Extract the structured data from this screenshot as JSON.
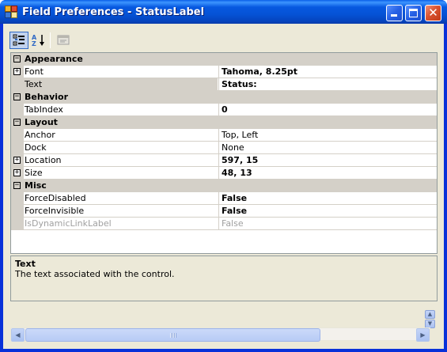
{
  "window": {
    "title": "Field Preferences - StatusLabel"
  },
  "toolbar": {
    "categorized_icon": "categorized-view-icon",
    "alphabetical_icon": "alphabetical-sort-icon",
    "property_pages_icon": "property-pages-icon"
  },
  "grid": {
    "rows": [
      {
        "type": "category",
        "name": "Appearance",
        "expand": "⊟"
      },
      {
        "type": "property",
        "name": "Font",
        "value": "Tahoma, 8.25pt",
        "expand": "+",
        "bold": true
      },
      {
        "type": "property",
        "name": "Text",
        "value": "Status:",
        "bold": true,
        "selected": true
      },
      {
        "type": "category",
        "name": "Behavior",
        "expand": "⊟"
      },
      {
        "type": "property",
        "name": "TabIndex",
        "value": "0",
        "bold": true
      },
      {
        "type": "category",
        "name": "Layout",
        "expand": "⊟"
      },
      {
        "type": "property",
        "name": "Anchor",
        "value": "Top, Left"
      },
      {
        "type": "property",
        "name": "Dock",
        "value": "None"
      },
      {
        "type": "property",
        "name": "Location",
        "value": "597, 15",
        "expand": "+",
        "bold": true
      },
      {
        "type": "property",
        "name": "Size",
        "value": "48, 13",
        "expand": "+",
        "bold": true
      },
      {
        "type": "category",
        "name": "Misc",
        "expand": "⊟"
      },
      {
        "type": "property",
        "name": "ForceDisabled",
        "value": "False",
        "bold": true
      },
      {
        "type": "property",
        "name": "ForceInvisible",
        "value": "False",
        "bold": true
      },
      {
        "type": "property",
        "name": "IsDynamicLinkLabel",
        "value": "False",
        "disabled": true
      }
    ]
  },
  "help": {
    "title": "Text",
    "description": "The text associated with the control."
  },
  "colors": {
    "title_bar": "#0553d6",
    "close_button": "#d9522f",
    "category_row": "#d4d0c8",
    "window_bg": "#ece9d8"
  }
}
